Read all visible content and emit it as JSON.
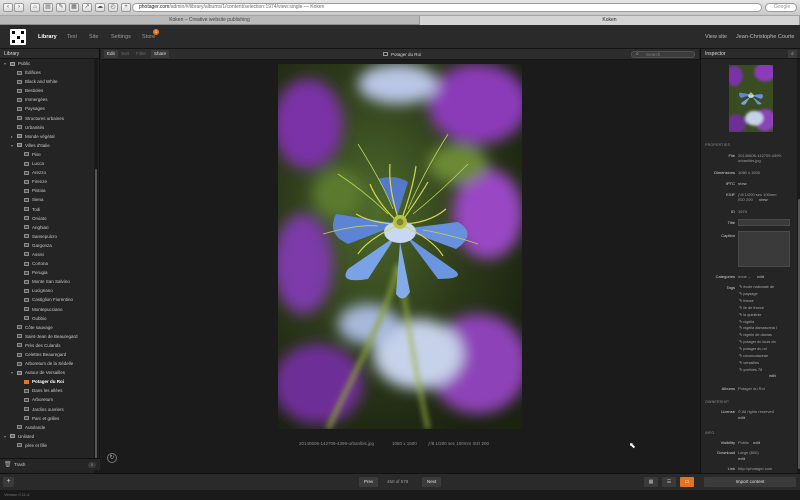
{
  "browser": {
    "url_domain": "photager.com",
    "url_path": "/admin/#/library/albums/1/content/selection:1974/view:single",
    "url_suffix": "— Koken",
    "search_placeholder": "Google",
    "tabs": [
      "Koken – Creative website publishing",
      "Koken"
    ]
  },
  "header": {
    "nav": [
      "Library",
      "Text",
      "Site",
      "Settings",
      "Store"
    ],
    "store_badge": "1",
    "view_site": "View site",
    "user": "Jean-Christophe Courte"
  },
  "library": {
    "title": "Library",
    "items": [
      {
        "label": "Public",
        "level": 0,
        "arrow": "▾",
        "kind": "set"
      },
      {
        "label": "Édifices",
        "level": 1,
        "kind": "album"
      },
      {
        "label": "Black and White",
        "level": 1,
        "kind": "album"
      },
      {
        "label": "Bestioles",
        "level": 1,
        "kind": "album"
      },
      {
        "label": "Immergées",
        "level": 1,
        "kind": "album"
      },
      {
        "label": "Paysages",
        "level": 1,
        "kind": "album"
      },
      {
        "label": "Structures urbaines",
        "level": 1,
        "kind": "album"
      },
      {
        "label": "Urbanités",
        "level": 1,
        "kind": "album"
      },
      {
        "label": "Monde végétal",
        "level": 1,
        "arrow": "▸",
        "kind": "set"
      },
      {
        "label": "Villes d'Italie",
        "level": 1,
        "arrow": "▾",
        "kind": "set"
      },
      {
        "label": "Pise",
        "level": 2,
        "kind": "album"
      },
      {
        "label": "Lucca",
        "level": 2,
        "kind": "album"
      },
      {
        "label": "Arezzo",
        "level": 2,
        "kind": "album"
      },
      {
        "label": "Firenze",
        "level": 2,
        "kind": "album"
      },
      {
        "label": "Pistoia",
        "level": 2,
        "kind": "album"
      },
      {
        "label": "Siena",
        "level": 2,
        "kind": "album"
      },
      {
        "label": "Todi",
        "level": 2,
        "kind": "album"
      },
      {
        "label": "Orviato",
        "level": 2,
        "kind": "album"
      },
      {
        "label": "Anghiari",
        "level": 2,
        "kind": "album"
      },
      {
        "label": "Sansepulcro",
        "level": 2,
        "kind": "album"
      },
      {
        "label": "Gargonza",
        "level": 2,
        "kind": "album"
      },
      {
        "label": "Assisi",
        "level": 2,
        "kind": "album"
      },
      {
        "label": "Cortona",
        "level": 2,
        "kind": "album"
      },
      {
        "label": "Perugia",
        "level": 2,
        "kind": "album"
      },
      {
        "label": "Monte San Salvino",
        "level": 2,
        "kind": "album"
      },
      {
        "label": "Lucignano",
        "level": 2,
        "kind": "album"
      },
      {
        "label": "Castiglion Fiorentino",
        "level": 2,
        "kind": "album"
      },
      {
        "label": "Montepucciano",
        "level": 2,
        "kind": "album"
      },
      {
        "label": "Gubbio",
        "level": 2,
        "kind": "album"
      },
      {
        "label": "Côte sauvage",
        "level": 1,
        "kind": "album"
      },
      {
        "label": "Saint-Jean de Beauregard",
        "level": 1,
        "kind": "album"
      },
      {
        "label": "Près des Culands",
        "level": 1,
        "kind": "album"
      },
      {
        "label": "Celettes Beauregard",
        "level": 1,
        "kind": "album"
      },
      {
        "label": "Arboretum de la Sédelle",
        "level": 1,
        "kind": "album"
      },
      {
        "label": "Autour de Versailles",
        "level": 1,
        "arrow": "▾",
        "kind": "set"
      },
      {
        "label": "Potager du Roi",
        "level": 2,
        "kind": "selected"
      },
      {
        "label": "Dans les allées",
        "level": 2,
        "kind": "album"
      },
      {
        "label": "Arboretum",
        "level": 2,
        "kind": "album"
      },
      {
        "label": "Jardins ouvriers",
        "level": 2,
        "kind": "album"
      },
      {
        "label": "Parc et grilles",
        "level": 2,
        "kind": "album"
      },
      {
        "label": "Autolande",
        "level": 1,
        "kind": "album"
      },
      {
        "label": "Unlisted",
        "level": 0,
        "arrow": "▾",
        "kind": "set"
      },
      {
        "label": "père et fille",
        "level": 1,
        "kind": "album"
      }
    ],
    "trash_label": "Trash",
    "trash_count": "0"
  },
  "toolbar": {
    "tabs": [
      "Edit",
      "Sort",
      "Filter",
      "Share"
    ],
    "title": "Potager du Roi",
    "search_placeholder": "Search"
  },
  "photo": {
    "filename": "20140606-142709-4399-urbanlbis.jpg",
    "dimensions": "1080 x 1500",
    "exif": "ƒ/8  1/200 sec  100mm  ISO 200"
  },
  "inspector": {
    "title": "Inspector",
    "sections": {
      "properties": "PROPERTIES",
      "ownership": "OWNERSHIP",
      "info": "INFO"
    },
    "rows": {
      "file_k": "File",
      "file_v": "20140606-142709-4399-urbanlbis.jpg",
      "dim_k": "Dimensions",
      "dim_v": "1080 x 1500",
      "iptc_k": "IPTC",
      "iptc_v": "view",
      "exif_k": "EXIF",
      "exif_v1": "ƒ/8  1/200 sec  100mm",
      "exif_v2": "ISO 200",
      "exif_view": "view",
      "id_k": "ID",
      "id_v": "1974",
      "title_k": "Title",
      "caption_k": "Caption",
      "cat_k": "Categories",
      "cat_v": "none –",
      "cat_edit": "edit",
      "tags_k": "Tags",
      "album_k": "Albums",
      "album_v": "Potager du Roi",
      "license_k": "License",
      "license_v": "© All rights reserved",
      "license_edit": "edit",
      "vis_k": "Visibility",
      "vis_v": "Public",
      "vis_edit": "edit",
      "dl_k": "Download",
      "dl_v": "Large (800)",
      "dl_edit": "edit",
      "link_k": "Link",
      "link_v": "http://photager.com"
    },
    "tags": [
      "école nationale de",
      "paysage",
      "france",
      "ile de france",
      "la quintinie",
      "nigella",
      "nigella damascena l",
      "nigelle de damas",
      "potager du louis xiv",
      "potager du roi",
      "ranunculaceae",
      "versailles",
      "yvelines 78"
    ],
    "tags_edit": "edit"
  },
  "footer": {
    "prev": "Prev",
    "counter": "450 of 578",
    "next": "Next",
    "import": "Import content",
    "version": "Version 0.11.4"
  },
  "colors": {
    "accent": "#e8731c",
    "bg": "#1b1b1b",
    "panel": "#252525"
  },
  "icons": [
    "back-icon",
    "forward-icon",
    "add-icon",
    "grid-view-icon",
    "list-view-icon",
    "single-view-icon",
    "search-icon",
    "rotate-icon"
  ]
}
